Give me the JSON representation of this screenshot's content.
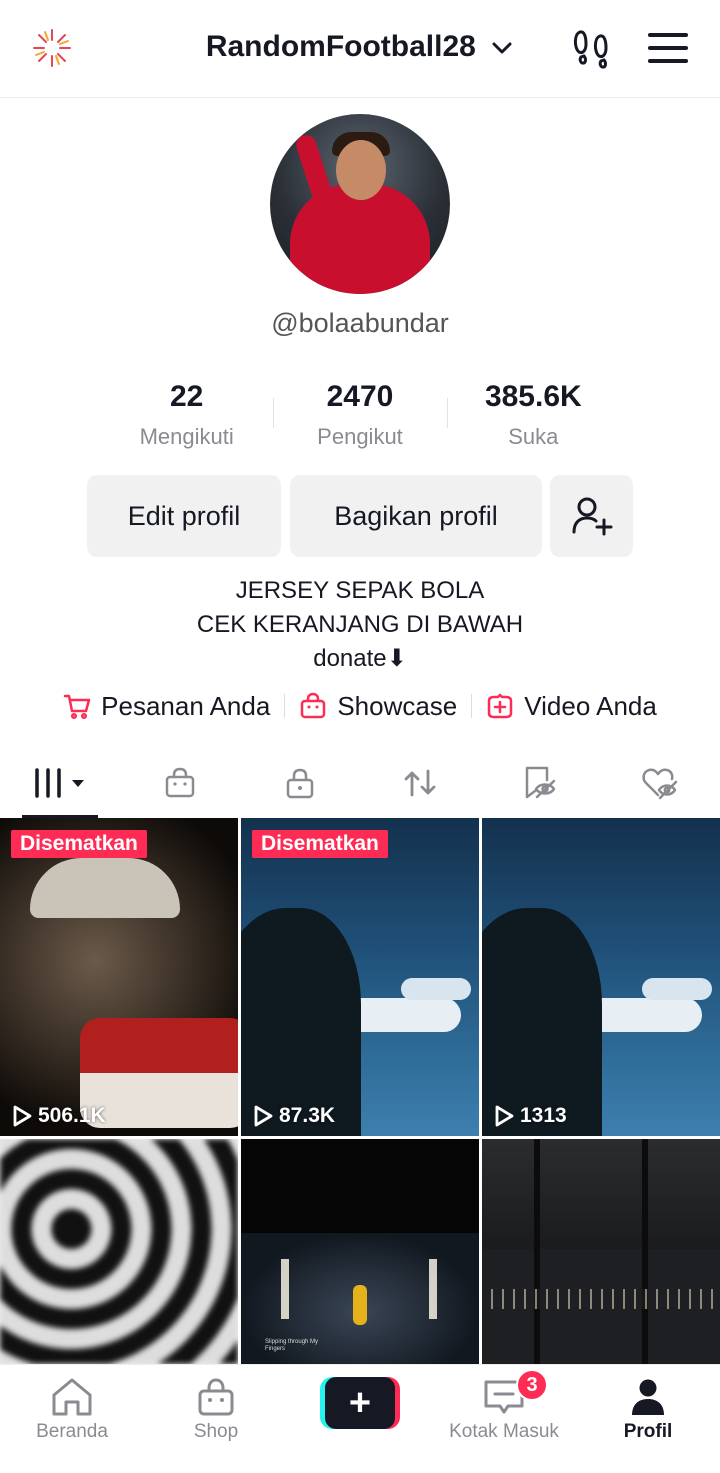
{
  "header": {
    "username": "RandomFootball28",
    "icons": [
      "sparkle-icon",
      "chevron-down-icon",
      "footprints-icon",
      "menu-icon"
    ]
  },
  "profile": {
    "handle": "@bolaabundar",
    "stats": [
      {
        "value": "22",
        "label": "Mengikuti"
      },
      {
        "value": "2470",
        "label": "Pengikut"
      },
      {
        "value": "385.6K",
        "label": "Suka"
      }
    ],
    "buttons": {
      "edit": "Edit profil",
      "share": "Bagikan profil"
    },
    "bio": [
      "JERSEY SEPAK BOLA",
      "CEK KERANJANG DI BAWAH",
      "donate⬇"
    ],
    "links": [
      {
        "label": "Pesanan Anda",
        "icon": "cart-icon"
      },
      {
        "label": "Showcase",
        "icon": "bag-icon"
      },
      {
        "label": "Video Anda",
        "icon": "video-plus-icon"
      }
    ]
  },
  "tabs": [
    "videos-grid-icon",
    "shop-bag-icon",
    "lock-icon",
    "repost-icon",
    "favorites-icon",
    "liked-hidden-icon"
  ],
  "videos": [
    {
      "pinned": "Disematkan",
      "views": "506.1K"
    },
    {
      "pinned": "Disematkan",
      "views": "87.3K"
    },
    {
      "views": "1313"
    },
    {},
    {
      "caption": "Slipping through My Fingers"
    },
    {}
  ],
  "bottom_nav": {
    "items": [
      {
        "label": "Beranda",
        "icon": "home-icon"
      },
      {
        "label": "Shop",
        "icon": "shop-icon"
      },
      {
        "label": "",
        "icon": "create-plus-icon"
      },
      {
        "label": "Kotak Masuk",
        "icon": "inbox-icon",
        "badge": "3"
      },
      {
        "label": "Profil",
        "icon": "profile-icon"
      }
    ]
  },
  "colors": {
    "accent": "#fe2c55",
    "cyan": "#25f4ee",
    "text": "#161823",
    "muted": "#8a8b91"
  }
}
